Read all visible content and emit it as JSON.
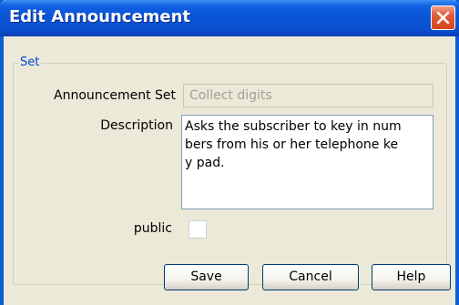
{
  "window": {
    "title": "Edit Announcement",
    "close_icon": "close-icon"
  },
  "group": {
    "label": "Set"
  },
  "form": {
    "announcement_set_label": "Announcement Set",
    "announcement_set_value": "Collect digits",
    "description_label": "Description",
    "description_lines": [
      "Asks the subscriber to key in num",
      "bers from his or her telephone ke",
      "y pad."
    ],
    "public_label": "public",
    "public_checked": false
  },
  "buttons": {
    "save": "Save",
    "cancel": "Cancel",
    "help": "Help"
  },
  "colors": {
    "title_bar": "#0a53d6",
    "close_button": "#d4451f",
    "group_label": "#0046d5",
    "dialog_background": "#ece9d8"
  }
}
